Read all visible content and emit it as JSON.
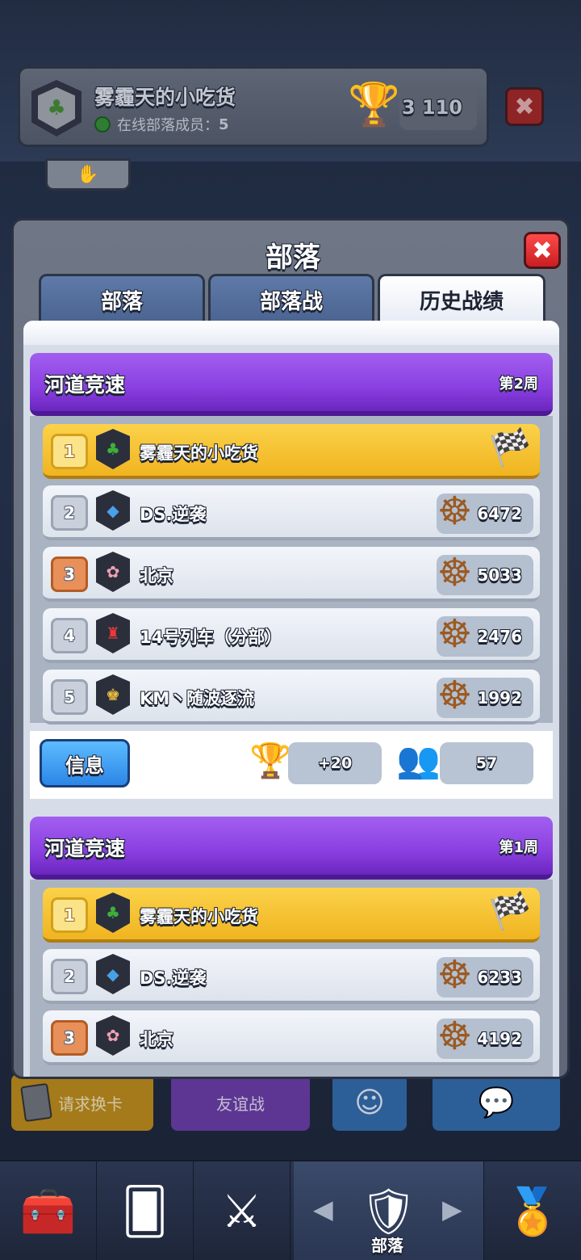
{
  "background": {
    "clan_name": "雾霾天的小吃货",
    "online_label": "在线部落成员：",
    "online_count": "5",
    "trophies": "3 110"
  },
  "action_buttons": {
    "request_cards": "请求换卡",
    "friendly_battle": "友谊战"
  },
  "nav": {
    "active_label": "部落"
  },
  "modal": {
    "title": "部落",
    "tabs": [
      "部落",
      "部落战",
      "历史战绩"
    ],
    "active_tab": "历史战绩"
  },
  "weeks": [
    {
      "title": "河道竞速",
      "week_label": "第2周",
      "rows": [
        {
          "rank": "1",
          "name": "雾霾天的小吃货",
          "score": "",
          "finished": true
        },
        {
          "rank": "2",
          "name": "DS.逆袭",
          "score": "6472"
        },
        {
          "rank": "3",
          "name": "北京",
          "score": "5033"
        },
        {
          "rank": "4",
          "name": "14号列车（分部）",
          "score": "2476"
        },
        {
          "rank": "5",
          "name": "KM丶随波逐流",
          "score": "1992"
        }
      ],
      "info": {
        "button": "信息",
        "trophy_change": "+20",
        "participants": "57"
      }
    },
    {
      "title": "河道竞速",
      "week_label": "第1周",
      "rows": [
        {
          "rank": "1",
          "name": "雾霾天的小吃货",
          "score": "",
          "finished": true
        },
        {
          "rank": "2",
          "name": "DS.逆袭",
          "score": "6233"
        },
        {
          "rank": "3",
          "name": "北京",
          "score": "4192"
        }
      ]
    }
  ],
  "colors": {
    "purple_banner": "#8a3fe0",
    "gold_row": "#f0b420",
    "info_button": "#2c86e6",
    "close_red": "#e3262a"
  }
}
